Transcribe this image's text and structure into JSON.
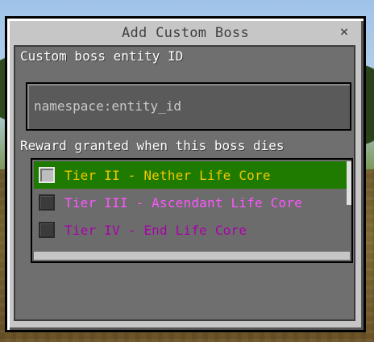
{
  "dialog": {
    "title": "Add Custom Boss",
    "close_glyph": "×",
    "entity_id_label": "Custom boss entity ID",
    "entity_id_placeholder": "namespace:entity_id",
    "entity_id_value": "",
    "reward_label": "Reward granted when this boss dies",
    "rewards": [
      {
        "label": "Tier II - Nether Life Core",
        "color": "#f0c800",
        "selected": true
      },
      {
        "label": "Tier III - Ascendant Life Core",
        "color": "#ff55ff",
        "selected": false
      },
      {
        "label": "Tier IV - End Life Core",
        "color": "#aa00aa",
        "selected": false
      }
    ]
  },
  "colors": {
    "dialog_bg": "#c6c6c6",
    "selected_row": "#1f7a00",
    "text_white": "#ffffff"
  }
}
